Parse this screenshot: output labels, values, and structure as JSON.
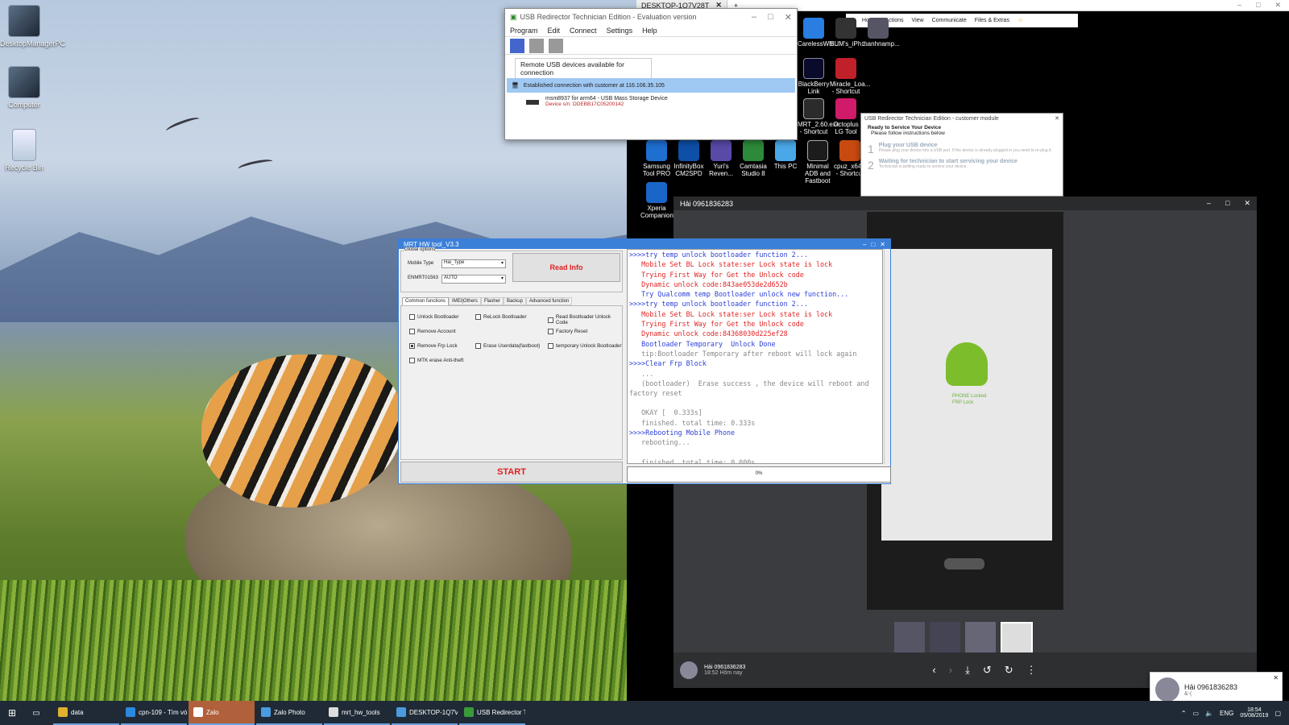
{
  "desktop": {
    "icons": [
      {
        "label": "DesktopManagerPC"
      },
      {
        "label": "Computer"
      },
      {
        "label": "Recycle Bin"
      }
    ]
  },
  "remote_tab": {
    "label": "DESKTOP-1Q7V28T"
  },
  "remote_toolbar": {
    "items": [
      "Home",
      "Actions",
      "View",
      "Communicate",
      "Files & Extras"
    ]
  },
  "remote_icons": [
    {
      "label": "CarelessWhi..."
    },
    {
      "label": "BUM's_iPh..."
    },
    {
      "label": "thanhnamp..."
    },
    {
      "label": "BlackBerry Link"
    },
    {
      "label": "Miracle_Loa... - Shortcut"
    },
    {
      "label": "MRT_2.60.exe - Shortcut"
    },
    {
      "label": "Octoplus LG Tool"
    },
    {
      "label": "Samsung Tool PRO"
    },
    {
      "label": "InfinityBox CM2SPD"
    },
    {
      "label": "Yuri's Reven..."
    },
    {
      "label": "Camtasia Studio 8"
    },
    {
      "label": "This PC"
    },
    {
      "label": "Minimal ADB and Fastboot"
    },
    {
      "label": "cpuz_x64.exe - Shortcut"
    },
    {
      "label": "Xperia Companion"
    }
  ],
  "usb_redirector": {
    "title": "USB Redirector Technician Edition - Evaluation version",
    "menu": [
      "Program",
      "Edit",
      "Connect",
      "Settings",
      "Help"
    ],
    "list_header": "Remote USB devices available for connection",
    "connection": "Established connection with customer at 116.106.35.105",
    "device_name": "msm8937 for arm64 - USB Mass Storage Device",
    "device_serial": "Device s/n: DDEBB17C05200142"
  },
  "customer_module": {
    "title": "USB Redirector Technician Edition - customer module",
    "heading": "Ready to Service Your Device",
    "sub": "Please follow instructions below",
    "steps": [
      {
        "num": "1",
        "title": "Plug your USB device",
        "desc": "Please plug your device into a USB port. If the device is already plugged in you need to re-plug it."
      },
      {
        "num": "2",
        "title": "Waiting for technician to start servicing your device",
        "desc": "Technician is getting ready to service your device."
      }
    ]
  },
  "mrt": {
    "title": "MRT HW tool_V3.3",
    "global_options": "Global options",
    "mobile_type_label": "Mobile Type",
    "mobile_type_value": "Hai_Type",
    "enmrt_label": "ENMRT01563",
    "enmrt_value": "AUTO",
    "read_info": "Read Info",
    "tabs": [
      "Common functions",
      "IMEI|Others",
      "Flasher",
      "Backup",
      "Advanced function"
    ],
    "checkboxes": [
      {
        "label": "Unlock Bootloader",
        "checked": false
      },
      {
        "label": "ReLock Bootloader",
        "checked": false
      },
      {
        "label": "Read Bootloader Unlock Code",
        "checked": false
      },
      {
        "label": "Remove Account",
        "checked": false
      },
      {
        "label": "Factory Reset",
        "checked": false
      },
      {
        "label": "Remove Frp Lock",
        "checked": true
      },
      {
        "label": "Erase Userdata(fastboot)",
        "checked": false
      },
      {
        "label": "temporary Unlock Bootloader",
        "checked": false
      },
      {
        "label": "MTK erase Anti-theft",
        "checked": false
      }
    ],
    "start": "START",
    "progress": "0%",
    "progress_value": 0,
    "log": [
      {
        "t": ">>>>try temp unlock bootloader function 2...",
        "c": "#2b3fd6"
      },
      {
        "t": "   Mobile Set BL Lock state:ser Lock state is lock",
        "c": "#e02424"
      },
      {
        "t": "   Trying First Way for Get the Unlock code",
        "c": "#e02424"
      },
      {
        "t": "   Dynamic unlock code:843ae053de2d652b",
        "c": "#e02424"
      },
      {
        "t": "   Try Qualcomm temp Bootloader unlock new function...",
        "c": "#2b3fd6"
      },
      {
        "t": ">>>>try temp unlock bootloader function 2...",
        "c": "#2b3fd6"
      },
      {
        "t": "   Mobile Set BL Lock state:ser Lock state is lock",
        "c": "#e02424"
      },
      {
        "t": "   Trying First Way for Get the Unlock code",
        "c": "#e02424"
      },
      {
        "t": "   Dynamic unlock code:84368030d225ef28",
        "c": "#e02424"
      },
      {
        "t": "   Bootloader Temporary  Unlock Done",
        "c": "#2b3fd6"
      },
      {
        "t": "   tip:Bootloader Temporary after reboot will lock again",
        "c": "#888"
      },
      {
        "t": ">>>>Clear Frp Block",
        "c": "#2b3fd6"
      },
      {
        "t": "   ...",
        "c": "#888"
      },
      {
        "t": "   (bootloader)  Erase success , the device will reboot and factory reset",
        "c": "#888"
      },
      {
        "t": "",
        "c": "#888"
      },
      {
        "t": "   OKAY [  0.333s]",
        "c": "#888"
      },
      {
        "t": "   finished. total time: 0.333s",
        "c": "#888"
      },
      {
        "t": ">>>>Rebooting Mobile Phone",
        "c": "#2b3fd6"
      },
      {
        "t": "   rebooting...",
        "c": "#888"
      },
      {
        "t": "",
        "c": "#888"
      },
      {
        "t": "   finished. total time: 0.000s",
        "c": "#888"
      }
    ]
  },
  "photo_viewer": {
    "title": "Hải 0961836283",
    "sender": "Hải 0961836283",
    "time": "18:52 Hôm nay",
    "phone_text_1": "PHONE Locked",
    "phone_text_2": "FRP Lock"
  },
  "zalo_notify": {
    "name": "Hải 0961836283",
    "msg": "&-("
  },
  "taskbar": {
    "items": [
      {
        "label": "data"
      },
      {
        "label": "cpn-109 - Tìm với G..."
      },
      {
        "label": "Zalo"
      },
      {
        "label": "Zalo Photo"
      },
      {
        "label": "mrt_hw_tools"
      },
      {
        "label": "DESKTOP-1Q7V28T..."
      },
      {
        "label": "USB Redirector Tec..."
      }
    ],
    "lang": "ENG",
    "time": "18:54",
    "date": "05/08/2019"
  }
}
